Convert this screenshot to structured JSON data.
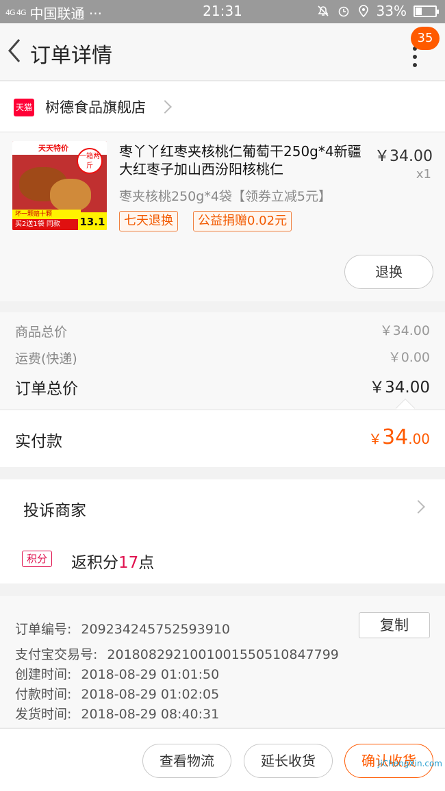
{
  "status": {
    "signal": "4G 4G",
    "carrier": "中国联通 ···",
    "time": "21:31",
    "battery": "33%",
    "battery_level": 0.33
  },
  "header": {
    "title": "订单详情",
    "badge": "35"
  },
  "shop": {
    "badge": "天猫",
    "name": "树德食品旗舰店"
  },
  "product": {
    "image": {
      "top": "天天特价",
      "tag": "一箱两斤",
      "banner1": "坏一颗赔十颗",
      "banner2": "买2送1袋 同款",
      "price": "13.1"
    },
    "title": "枣丫丫红枣夹核桃仁葡萄干250g*4新疆大红枣子加山西汾阳核桃仁",
    "price": "￥34.00",
    "qty": "x1",
    "sku": "枣夹核桃250g*4袋【领券立减5元】",
    "tags": [
      "七天退换",
      "公益捐赠0.02元"
    ],
    "refund_button": "退换"
  },
  "prices": {
    "goods_label": "商品总价",
    "goods_value": "￥34.00",
    "shipping_label": "运费(快递)",
    "shipping_value": "￥0.00",
    "total_label": "订单总价",
    "total_value": "￥34.00"
  },
  "paid": {
    "label": "实付款",
    "currency": "￥",
    "integer": "34",
    "decimal": ".00"
  },
  "services": {
    "complain": "投诉商家",
    "points_badge": "积分",
    "points_prefix": "返积分",
    "points_num": "17",
    "points_suffix": "点"
  },
  "info": {
    "order_no_label": "订单编号:",
    "order_no": "209234245752593910",
    "copy_button": "复制",
    "alipay_label": "支付宝交易号:",
    "alipay_no": "2018082921001001550510847799",
    "created_label": "创建时间:",
    "created": "2018-08-29 01:01:50",
    "paid_label": "付款时间:",
    "paid": "2018-08-29 01:02:05",
    "shipped_label": "发货时间:",
    "shipped": "2018-08-29 08:40:31"
  },
  "footer": {
    "logistics": "查看物流",
    "extend": "延长收货",
    "confirm": "确认收货"
  },
  "watermark": "JiChengXin.com"
}
